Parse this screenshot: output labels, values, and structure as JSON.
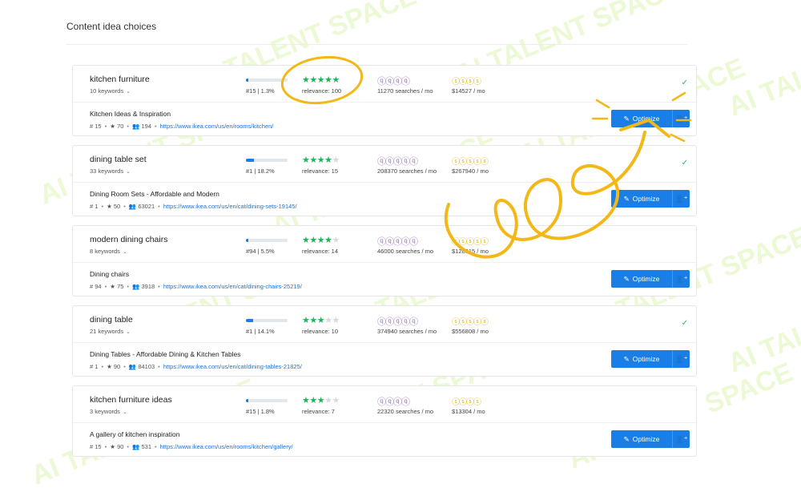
{
  "header": {
    "title": "Content idea choices"
  },
  "watermark": "AI TALENT SPACE",
  "optimize_label": "Optimize",
  "cards": [
    {
      "keyword": "kitchen furniture",
      "keywords_count": "10 keywords",
      "rank_text": "#15 | 1.3%",
      "rank_fraction": 0.05,
      "stars": 5,
      "relevance": "relevance: 100",
      "q_icons": "ⓠⓠⓠⓠ",
      "searches": "11270 searches / mo",
      "d_icons": "ⓢⓢⓢⓢ",
      "d_empty": "",
      "value": "$14527 / mo",
      "checked": true,
      "page_title": "Kitchen Ideas & Inspiration",
      "rank_num": "15",
      "rating": "70",
      "users": "194",
      "url": "https://www.ikea.com/us/en/rooms/kitchen/"
    },
    {
      "keyword": "dining table set",
      "keywords_count": "33 keywords",
      "rank_text": "#1 | 18.2%",
      "rank_fraction": 0.2,
      "stars": 4,
      "relevance": "relevance: 15",
      "q_icons": "ⓠⓠⓠⓠⓠ",
      "searches": "208370 searches / mo",
      "d_icons": "ⓢⓢⓢⓢⓢ",
      "d_empty": "",
      "value": "$267940 / mo",
      "checked": true,
      "page_title": "Dining Room Sets - Affordable and Modern",
      "rank_num": "1",
      "rating": "50",
      "users": "63021",
      "url": "https://www.ikea.com/us/en/cat/dining-sets-19145/"
    },
    {
      "keyword": "modern dining chairs",
      "keywords_count": "8 keywords",
      "rank_text": "#94 | 5.5%",
      "rank_fraction": 0.06,
      "stars": 4,
      "relevance": "relevance: 14",
      "q_icons": "ⓠⓠⓠⓠⓠ",
      "searches": "46000 searches / mo",
      "d_icons": "ⓢⓢⓢⓢⓢ",
      "d_empty": "",
      "value": "$128315 / mo",
      "checked": false,
      "page_title": "Dining chairs",
      "rank_num": "94",
      "rating": "75",
      "users": "3918",
      "url": "https://www.ikea.com/us/en/cat/dining-chairs-25219/"
    },
    {
      "keyword": "dining table",
      "keywords_count": "21 keywords",
      "rank_text": "#1 | 14.1%",
      "rank_fraction": 0.18,
      "stars": 3,
      "relevance": "relevance: 10",
      "q_icons": "ⓠⓠⓠⓠⓠ",
      "searches": "374940 searches / mo",
      "d_icons": "ⓢⓢⓢⓢⓢ",
      "d_empty": "",
      "value": "$556808 / mo",
      "checked": true,
      "page_title": "Dining Tables - Affordable Dining & Kitchen Tables",
      "rank_num": "1",
      "rating": "90",
      "users": "84103",
      "url": "https://www.ikea.com/us/en/cat/dining-tables-21825/"
    },
    {
      "keyword": "kitchen furniture ideas",
      "keywords_count": "3 keywords",
      "rank_text": "#15 | 1.8%",
      "rank_fraction": 0.05,
      "stars": 3,
      "relevance": "relevance: 7",
      "q_icons": "ⓠⓠⓠⓠ",
      "searches": "22320 searches / mo",
      "d_icons": "ⓢⓢⓢⓢ",
      "d_empty": "",
      "value": "$13304 / mo",
      "checked": false,
      "page_title": "A gallery of kitchen inspiration",
      "rank_num": "15",
      "rating": "90",
      "users": "531",
      "url": "https://www.ikea.com/us/en/rooms/kitchen/gallery/"
    }
  ],
  "colors": {
    "accent": "#1a7ee6",
    "stars_on": "#21b35a",
    "annotation": "#f3b817",
    "watermark": "#c8ef8a"
  }
}
